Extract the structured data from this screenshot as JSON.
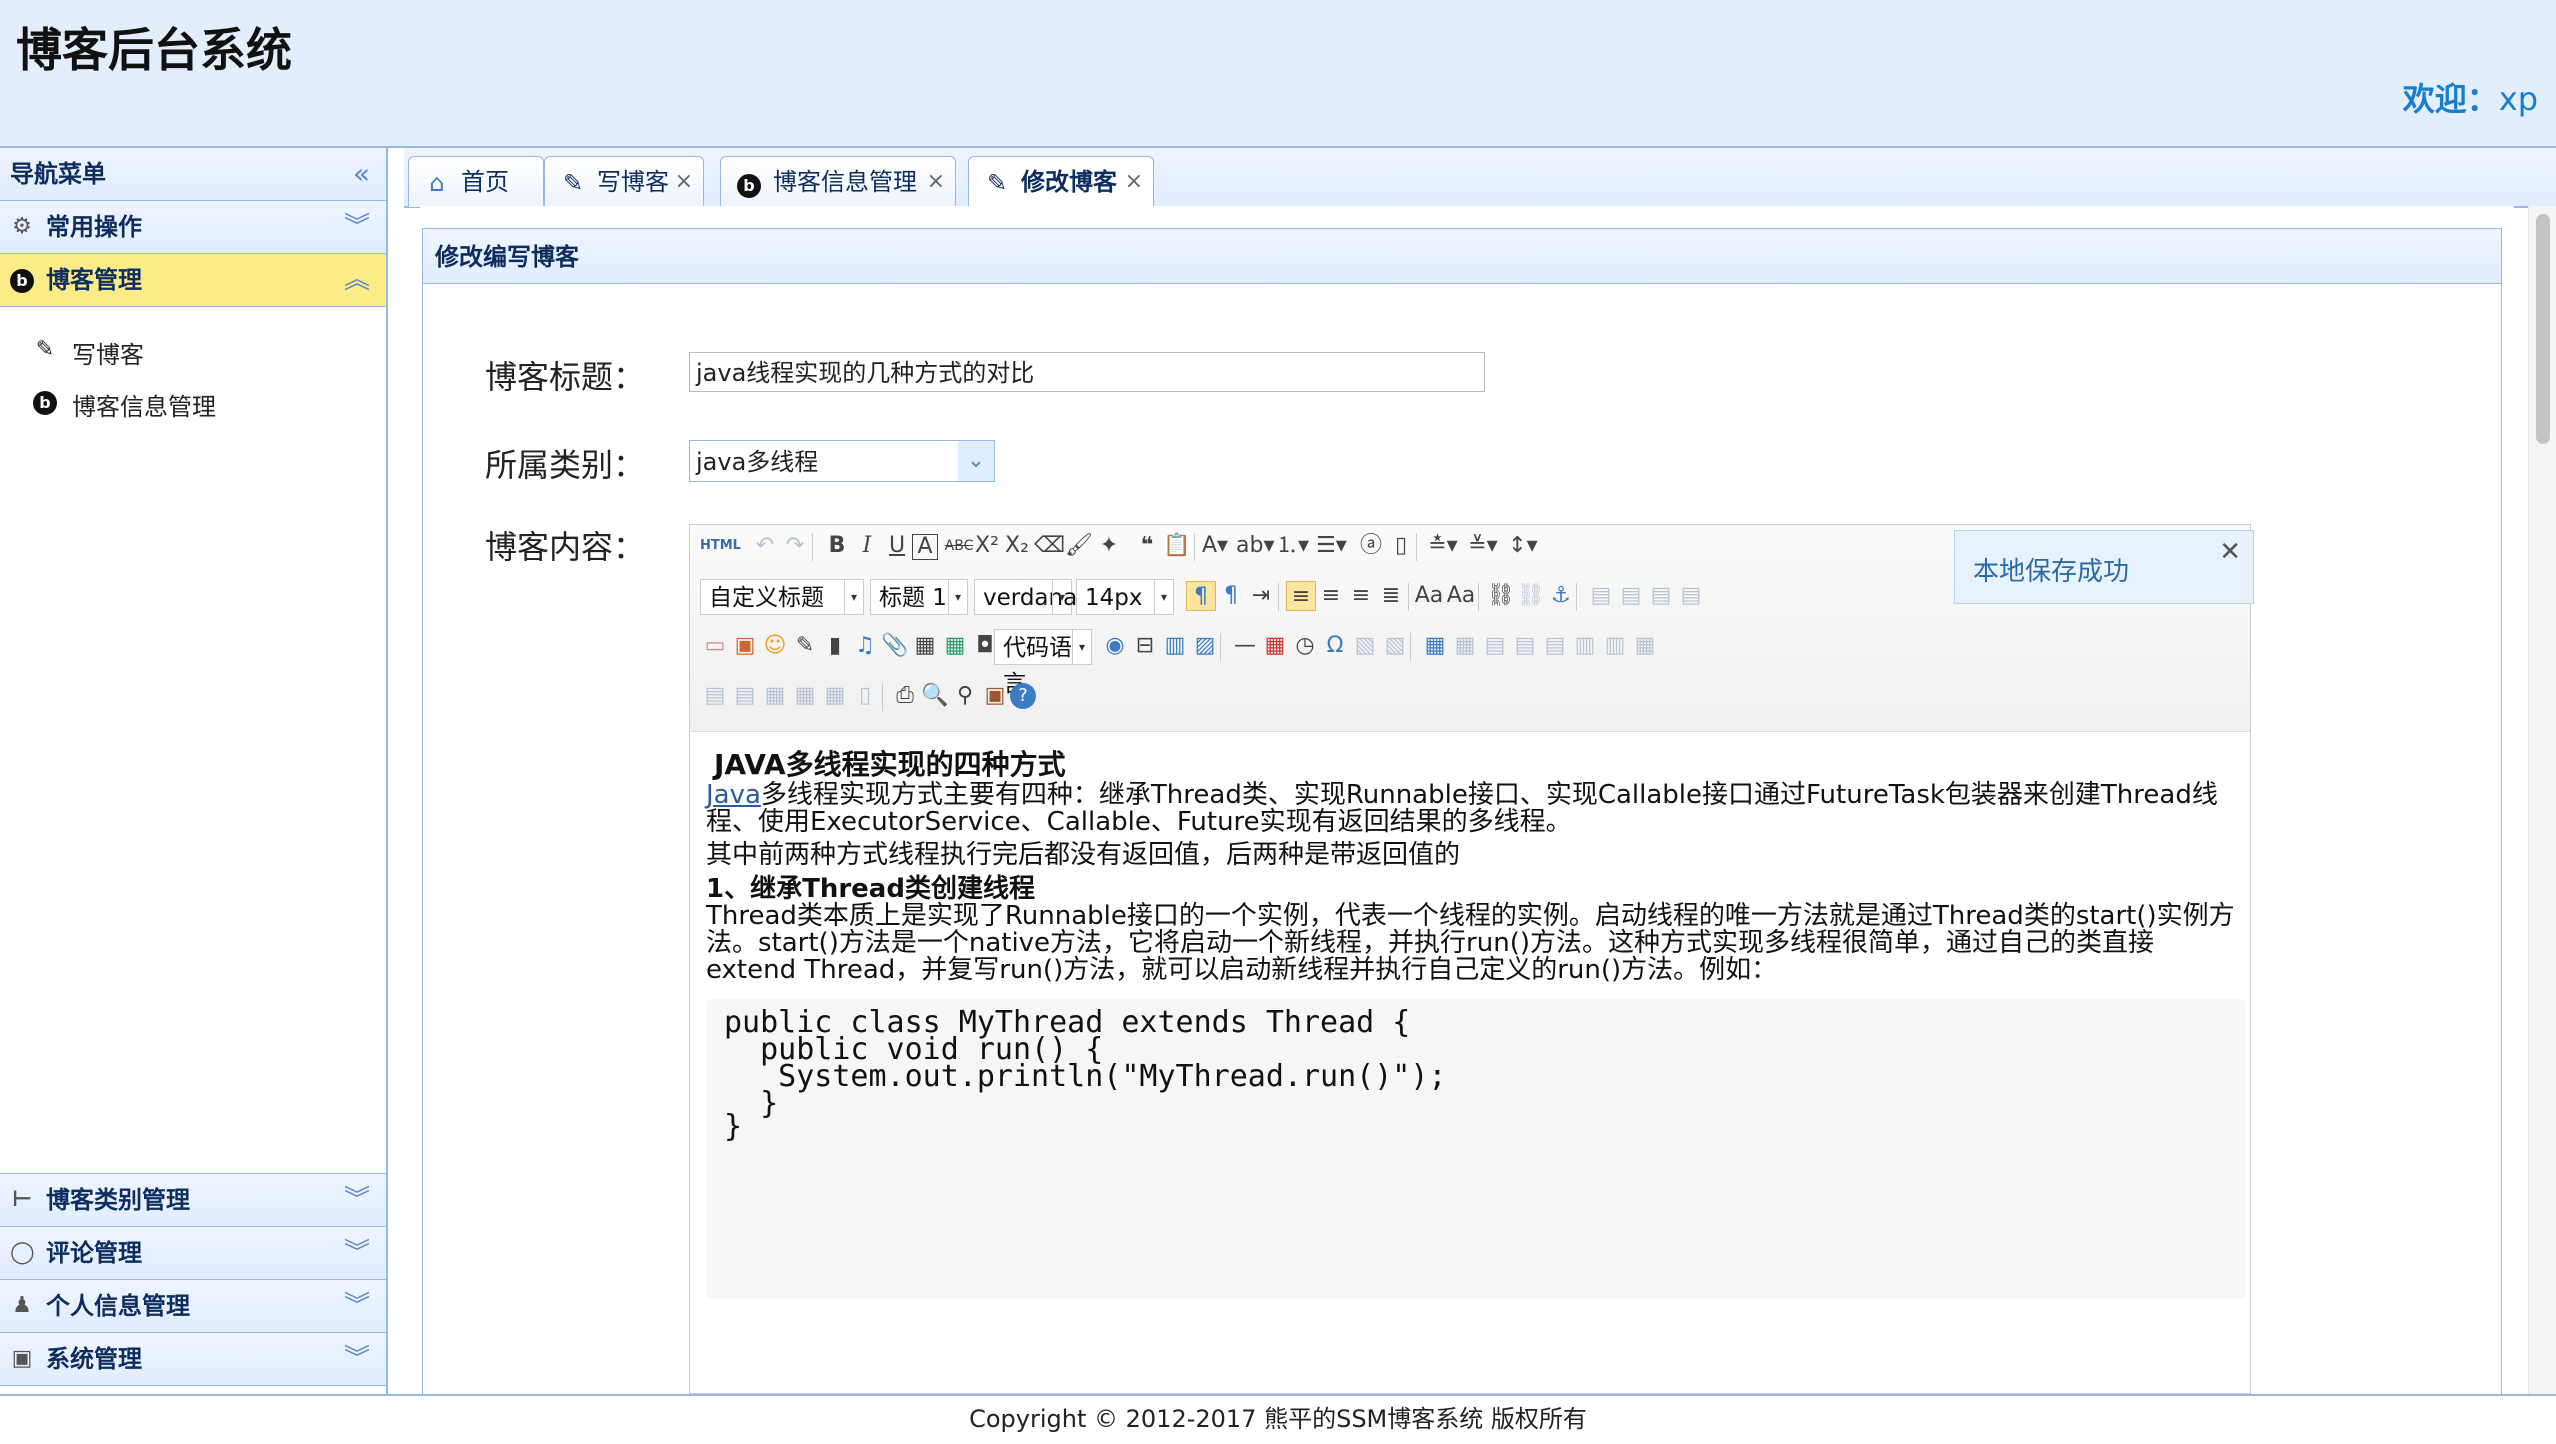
{
  "header": {
    "title": "博客后台系统",
    "welcome_label": "欢迎：",
    "username": "xp"
  },
  "sidebar": {
    "title": "导航菜单",
    "sections": [
      {
        "label": "常用操作",
        "icon": "gear-icon"
      },
      {
        "label": "博客管理",
        "icon": "blog-icon",
        "active": true
      },
      {
        "label": "博客类别管理",
        "icon": "tree-icon"
      },
      {
        "label": "评论管理",
        "icon": "comment-icon"
      },
      {
        "label": "个人信息管理",
        "icon": "user-icon"
      },
      {
        "label": "系统管理",
        "icon": "system-icon"
      }
    ],
    "blog_items": [
      {
        "label": "写博客",
        "icon": "edit-icon"
      },
      {
        "label": "博客信息管理",
        "icon": "blog-icon"
      }
    ]
  },
  "tabs": [
    {
      "label": "首页",
      "icon": "home-icon",
      "closable": false
    },
    {
      "label": "写博客",
      "icon": "edit-icon",
      "closable": true
    },
    {
      "label": "博客信息管理",
      "icon": "blog-icon",
      "closable": true
    },
    {
      "label": "修改博客",
      "icon": "edit-icon",
      "closable": true,
      "active": true
    }
  ],
  "panel": {
    "title": "修改编写博客"
  },
  "form": {
    "title_label": "博客标题：",
    "title_value": "java线程实现的几种方式的对比",
    "type_label": "所属类别：",
    "type_value": "java多线程",
    "content_label": "博客内容："
  },
  "editor": {
    "custom_title_select": "自定义标题",
    "heading_select": "标题 1",
    "font_select": "verdana",
    "size_select": "14px",
    "code_lang_select": "代码语言",
    "html_btn": "HTML"
  },
  "document": {
    "heading": "JAVA多线程实现的四种方式",
    "p1_link": "Java",
    "p1_a": "多线程实现方式主要有四种：继承Thread类、实现Runnable接口、实现Callable接口通过FutureTask包装器来创建Thread线",
    "p1_b": "程、使用ExecutorService、Callable、Future实现有返回结果的多线程。",
    "p2": "其中前两种方式线程执行完后都没有返回值，后两种是带返回值的",
    "h2": "1、继承Thread类创建线程",
    "p3_a": "Thread类本质上是实现了Runnable接口的一个实例，代表一个线程的实例。启动线程的唯一方法就是通过Thread类的start()实例方",
    "p3_b": "法。start()方法是一个native方法，它将启动一个新线程，并执行run()方法。这种方式实现多线程很简单，通过自己的类直接",
    "p3_c": "extend Thread，并复写run()方法，就可以启动新线程并执行自己定义的run()方法。例如：",
    "code": [
      "public class MyThread extends Thread {",
      "  public void run() {",
      "   System.out.println(\"MyThread.run()\");",
      "  }",
      "}"
    ]
  },
  "toast": {
    "text": "本地保存成功"
  },
  "footer": {
    "copyright": "Copyright © 2012-2017 熊平的SSM博客系统 版权所有"
  },
  "colors": {
    "header_bg": "#e2eefb",
    "border": "#95b8e7",
    "active_section": "#fbec88",
    "welcome": "#1a7ecf"
  }
}
